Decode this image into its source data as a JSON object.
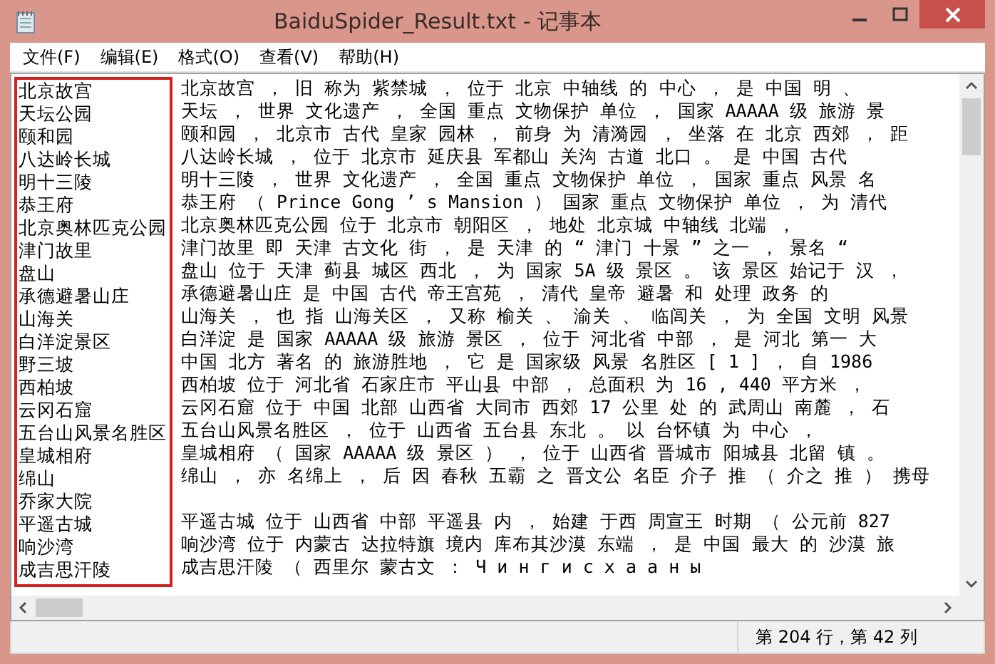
{
  "window": {
    "title": "BaiduSpider_Result.txt - 记事本"
  },
  "menu": [
    "文件(F)",
    "编辑(E)",
    "格式(O)",
    "查看(V)",
    "帮助(H)"
  ],
  "lines": [
    {
      "name": "北京故宫",
      "text": "北京故宫 ， 旧 称为 紫禁城 ， 位于 北京 中轴线 的 中心 ， 是 中国 明 、"
    },
    {
      "name": "天坛公园",
      "text": "天坛 ， 世界 文化遗产 ， 全国 重点 文物保护 单位 ， 国家 AAAAA 级 旅游 景"
    },
    {
      "name": "颐和园",
      "text": "颐和园 ， 北京市 古代 皇家 园林 ， 前身 为 清漪园 ， 坐落 在 北京 西郊 ， 距"
    },
    {
      "name": "八达岭长城",
      "text": "八达岭长城 ， 位于 北京市 延庆县 军都山 关沟 古道 北口 。 是 中国 古代"
    },
    {
      "name": "明十三陵",
      "text": "明十三陵 ， 世界 文化遗产 ， 全国 重点 文物保护 单位 ， 国家 重点 风景 名"
    },
    {
      "name": "恭王府",
      "text": "恭王府 （ Prince Gong ’ s Mansion ） 国家 重点 文物保护 单位 ， 为 清代"
    },
    {
      "name": "北京奥林匹克公园",
      "text": "北京奥林匹克公园 位于 北京市 朝阳区 ， 地处 北京城 中轴线 北端 ，"
    },
    {
      "name": "津门故里",
      "text": "津门故里 即 天津 古文化 街 ， 是 天津 的 “ 津门 十景 ” 之一 ， 景名 “"
    },
    {
      "name": "盘山",
      "text": "盘山 位于 天津 蓟县 城区 西北 ， 为 国家 5A 级 景区 。 该 景区 始记于 汉 ，"
    },
    {
      "name": "承德避暑山庄",
      "text": "承德避暑山庄 是 中国 古代 帝王宫苑 ， 清代 皇帝 避暑 和 处理 政务 的"
    },
    {
      "name": "山海关",
      "text": "山海关 ， 也 指 山海关区 ， 又称 榆关 、 渝关 、 临闾关 ， 为 全国 文明 风景"
    },
    {
      "name": "白洋淀景区",
      "text": "白洋淀 是 国家 AAAAA 级 旅游 景区 ， 位于 河北省 中部 ， 是 河北 第一 大"
    },
    {
      "name": "野三坡",
      "text": "中国 北方 著名 的 旅游胜地 ， 它 是 国家级 风景 名胜区 [ 1 ] ， 自 1986"
    },
    {
      "name": "西柏坡",
      "text": "西柏坡 位于 河北省 石家庄市 平山县 中部 ， 总面积 为 16 , 440 平方米 ，"
    },
    {
      "name": "云冈石窟",
      "text": "云冈石窟 位于 中国 北部 山西省 大同市 西郊 17 公里 处 的 武周山 南麓 ， 石"
    },
    {
      "name": "五台山风景名胜区",
      "text": "五台山风景名胜区 ， 位于 山西省 五台县 东北 。 以 台怀镇 为 中心 ，"
    },
    {
      "name": "皇城相府",
      "text": "皇城相府 （ 国家 AAAAA 级 景区 ） ， 位于 山西省 晋城市 阳城县 北留 镇 。"
    },
    {
      "name": "绵山",
      "text": "绵山 ， 亦 名绵上 ， 后 因 春秋 五霸 之 晋文公 名臣 介子 推 （ 介之 推 ） 携母"
    },
    {
      "name": "乔家大院"
    },
    {
      "name": "平遥古城",
      "text": "平遥古城 位于 山西省 中部 平遥县 内 ， 始建 于西 周宣王 时期 （ 公元前 827"
    },
    {
      "name": "响沙湾",
      "text": "响沙湾 位于 内蒙古 达拉特旗 境内 库布其沙漠 东端 ， 是 中国 最大 的 沙漠 旅"
    },
    {
      "name": "成吉思汗陵",
      "text": "成吉思汗陵 （ 西里尔 蒙古文 ： Ч и н г и с х а а н ы"
    }
  ],
  "status_bar": {
    "position": "第 204 行，第 42 列"
  }
}
